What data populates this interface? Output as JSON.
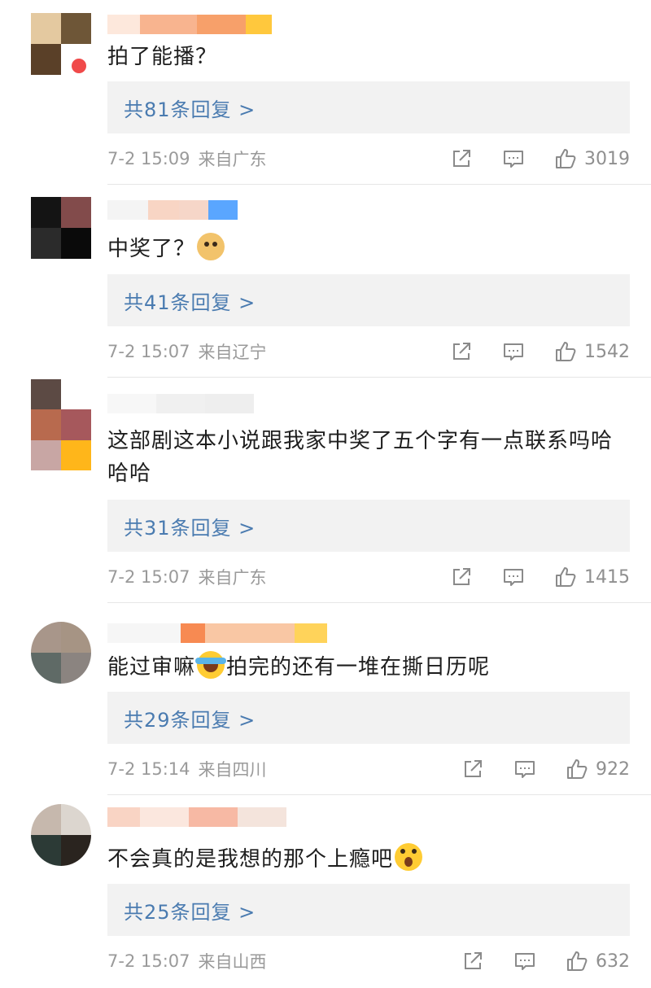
{
  "colors": {
    "reply_link": "#4a7bb0",
    "reply_bg": "#f2f2f2",
    "meta": "#9a9a9a"
  },
  "comments": [
    {
      "text": "拍了能播？",
      "emoji_after": "",
      "reply": "共81条回复 >",
      "time": "7-2 15:09",
      "location": "来自广东",
      "likes": "3019",
      "avatar_colors": [
        "#e4c9a0",
        "#6e5637",
        "#5a4028",
        "#ffffff"
      ],
      "name_colors": [
        "#fde8dc",
        "#f8b48f",
        "#f7a06a",
        "#ffc83d"
      ],
      "has_badge": true
    },
    {
      "text": "中奖了？",
      "emoji_after": "doge-icon",
      "reply": "共41条回复 >",
      "time": "7-2 15:07",
      "location": "来自辽宁",
      "likes": "1542",
      "avatar_colors": [
        "#141414",
        "#824b4b",
        "#2b2b2b",
        "#0a0a0a"
      ],
      "name_colors": [
        "#f4f4f4",
        "#f8d5c4",
        "#f6d6c8",
        "#5aa6ff"
      ],
      "has_badge": false
    },
    {
      "text": "这部剧这本小说跟我家中奖了五个字有一点联系吗哈哈哈",
      "emoji_after": "",
      "reply": "共31条回复 >",
      "time": "7-2 15:07",
      "location": "来自广东",
      "likes": "1415",
      "avatar_colors": [
        "#b86a4e",
        "#a6585c",
        "#c8a6a4",
        "#ffb61a"
      ],
      "name_colors": [
        "#f7f7f7",
        "#f0f0f0",
        "#eeeeee",
        "#f5f5f5"
      ],
      "has_badge": false
    },
    {
      "text": "能过审嘛",
      "emoji_after": "laughcry-icon",
      "text_after": "拍完的还有一堆在撕日历呢",
      "reply": "共29条回复 >",
      "time": "7-2 15:14",
      "location": "来自四川",
      "likes": "922",
      "avatar_colors": [
        "#a8968a",
        "#a69484",
        "#5f6a66",
        "#8b8480"
      ],
      "name_colors": [
        "#f6f6f6",
        "#f78a52",
        "#f9c7a4",
        "#ffd35a"
      ],
      "has_badge": false
    },
    {
      "text": "不会真的是我想的那个上瘾吧",
      "emoji_after": "shock-icon",
      "reply": "共25条回复 >",
      "time": "7-2 15:07",
      "location": "来自山西",
      "likes": "632",
      "avatar_colors": [
        "#c6b8ad",
        "#dcd6cf",
        "#2c3a36",
        "#2a241f"
      ],
      "name_colors": [
        "#f9d4c4",
        "#fbe7de",
        "#f7b9a4",
        "#f4e4dc"
      ],
      "has_badge": false
    }
  ]
}
